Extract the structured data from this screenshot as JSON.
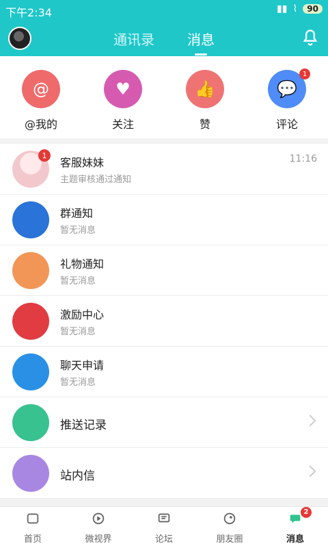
{
  "status": {
    "time": "下午2:34",
    "battery": "90"
  },
  "tabs": [
    {
      "label": "通讯录"
    },
    {
      "label": "消息"
    }
  ],
  "quick": [
    {
      "label": "@我的",
      "icon": "at-icon",
      "color": "#ef6b6b"
    },
    {
      "label": "关注",
      "icon": "heart-icon",
      "color": "#d65bb0"
    },
    {
      "label": "赞",
      "icon": "thumbs-up-icon",
      "color": "#ef7373"
    },
    {
      "label": "评论",
      "icon": "comment-icon",
      "color": "#4f8cf7",
      "badge": "1"
    }
  ],
  "list": [
    {
      "title": "客服妹妹",
      "sub": "主题审核通过通知",
      "time": "11:16",
      "badge": "1",
      "icon": "avatar-photo",
      "color": "#f0d6d6"
    },
    {
      "title": "群通知",
      "sub": "暂无消息",
      "icon": "group-icon",
      "color": "#2a73d8"
    },
    {
      "title": "礼物通知",
      "sub": "暂无消息",
      "icon": "gift-icon",
      "color": "#f29658"
    },
    {
      "title": "激励中心",
      "sub": "暂无消息",
      "icon": "medal-icon",
      "color": "#e13c42"
    },
    {
      "title": "聊天申请",
      "sub": "暂无消息",
      "icon": "chat-bubble-icon",
      "color": "#2a90e6"
    },
    {
      "title": "推送记录",
      "icon": "broadcast-icon",
      "color": "#38c28f"
    },
    {
      "title": "站内信",
      "icon": "mail-icon",
      "color": "#a887e3"
    }
  ],
  "bottom": [
    {
      "label": "首页",
      "icon": "home-icon"
    },
    {
      "label": "微视界",
      "icon": "video-icon"
    },
    {
      "label": "论坛",
      "icon": "forum-icon"
    },
    {
      "label": "朋友圈",
      "icon": "circle-icon"
    },
    {
      "label": "消息",
      "icon": "message-icon",
      "badge": "2"
    }
  ]
}
